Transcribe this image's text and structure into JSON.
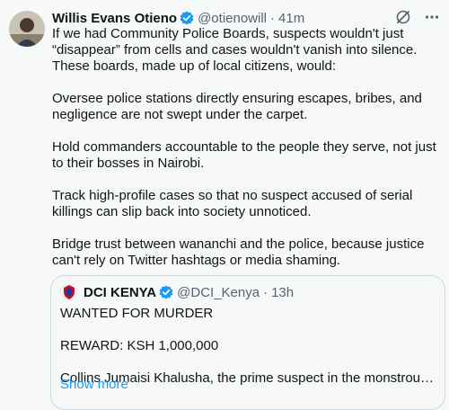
{
  "tweet": {
    "author_name": "Willis Evans Otieno",
    "author_handle": "@otienowill",
    "separator": "·",
    "time": "41m",
    "paragraphs": [
      "If we had Community Police Boards, suspects wouldn't just “disappear” from cells and cases wouldn't vanish into silence. These boards, made up of local citizens, would:",
      "Oversee police stations directly  ensuring escapes, bribes, and negligence are not swept under the carpet.",
      "Hold commanders accountable to the people they serve, not just to their bosses in Nairobi.",
      "Track high-profile cases so that no suspect accused of serial killings can slip back into society unnoticed.",
      "Bridge trust between wananchi and the police, because justice can't rely on Twitter hashtags or media shaming."
    ]
  },
  "quote": {
    "author_name": "DCI KENYA",
    "author_handle": "@DCI_Kenya",
    "separator": "·",
    "time": "13h",
    "lines": [
      "WANTED FOR MURDER",
      "REWARD: KSH 1,000,000",
      "Collins Jumaisi Khalusha, the prime suspect in the monstrous killing o..."
    ],
    "show_more": "Show more"
  },
  "colors": {
    "accent": "#1d9bf0",
    "muted": "#536471",
    "border": "#cfd9de",
    "background": "#f7f9f9"
  },
  "icons": [
    "grok-icon",
    "more-icon",
    "verified-badge-icon"
  ]
}
